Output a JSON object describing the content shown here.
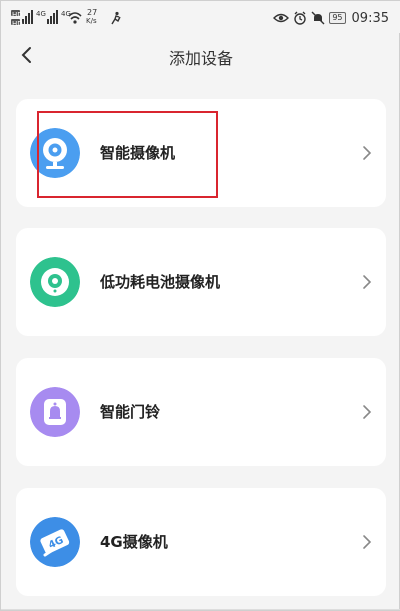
{
  "status_bar": {
    "net_speed_value": "27",
    "net_speed_unit": "K/s",
    "signal_label_1": "HD",
    "signal_label_2": "HD",
    "gen_label_1": "4G",
    "gen_label_2": "4G",
    "battery": "95",
    "time": "09:35"
  },
  "header": {
    "title": "添加设备"
  },
  "devices": [
    {
      "label": "智能摄像机",
      "icon": "smart-camera-icon",
      "color": "#4b9ef0"
    },
    {
      "label": "低功耗电池摄像机",
      "icon": "battery-camera-icon",
      "color": "#2ec28e"
    },
    {
      "label": "智能门铃",
      "icon": "doorbell-icon",
      "color": "#a78bf0"
    },
    {
      "label": "4G摄像机",
      "icon": "4g-camera-icon",
      "color": "#3d8ee6"
    }
  ],
  "icon_text": {
    "fourg": "4G"
  },
  "colors": {
    "highlight": "#d9252f",
    "background": "#f4f4f4",
    "card": "#ffffff"
  }
}
